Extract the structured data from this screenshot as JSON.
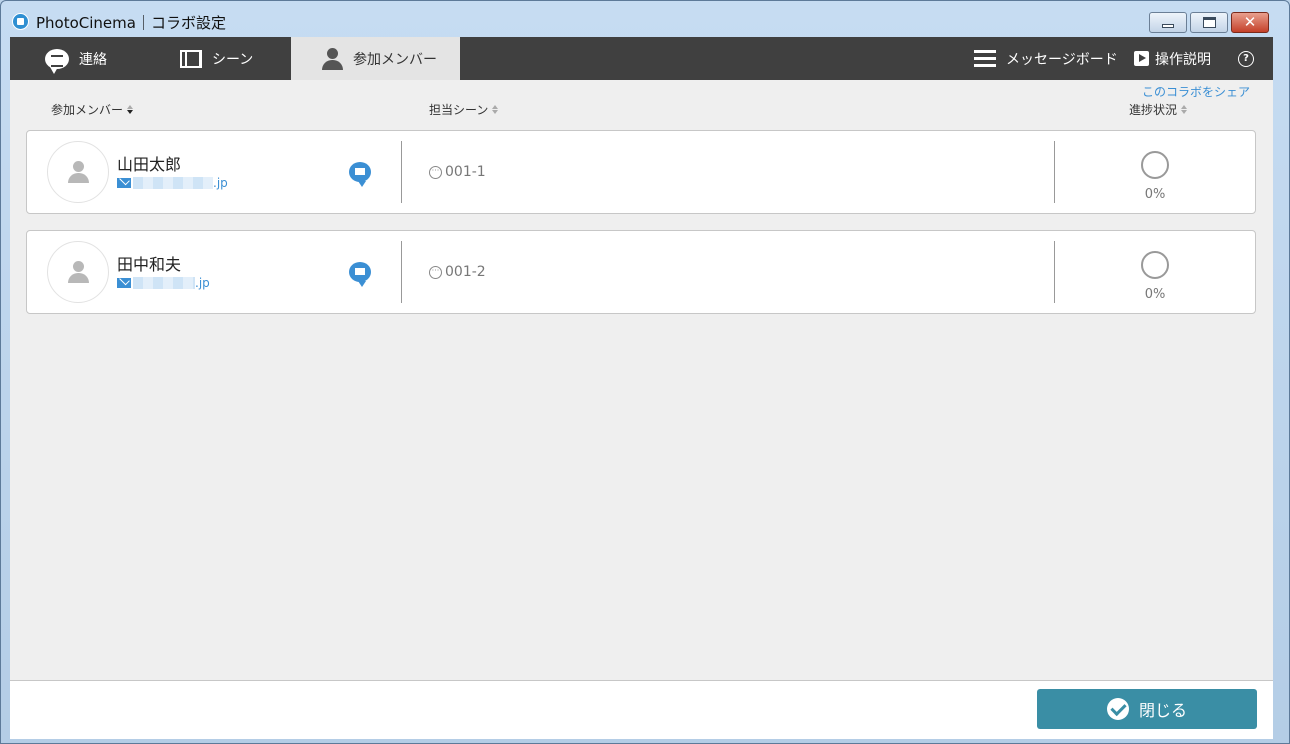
{
  "window": {
    "title": "PhotoCinema｜コラボ設定",
    "controls": {
      "minimize": "minimize",
      "maximize": "maximize",
      "close": "✕"
    }
  },
  "nav": {
    "tabs": [
      {
        "label": "連絡",
        "icon": "chat-icon"
      },
      {
        "label": "シーン",
        "icon": "film-icon"
      },
      {
        "label": "参加メンバー",
        "icon": "person-icon",
        "active": true
      }
    ],
    "right": [
      {
        "label": "メッセージボード",
        "icon": "list-icon"
      },
      {
        "label": "操作説明",
        "icon": "play-icon"
      },
      {
        "label": "?",
        "icon": "question-icon"
      }
    ]
  },
  "share_link": "このコラボをシェア",
  "columns": {
    "members": "参加メンバー",
    "scene": "担当シーン",
    "progress": "進捗状況"
  },
  "members": [
    {
      "name": "山田太郎",
      "email_suffix": ".jp",
      "scene": "001-1",
      "progress": "0%"
    },
    {
      "name": "田中和夫",
      "email_suffix": ".jp",
      "scene": "001-2",
      "progress": "0%"
    }
  ],
  "footer": {
    "close_label": "閉じる"
  },
  "colors": {
    "accent": "#3a8ea5",
    "nav_bg": "#404040",
    "link": "#3b8fd4"
  }
}
